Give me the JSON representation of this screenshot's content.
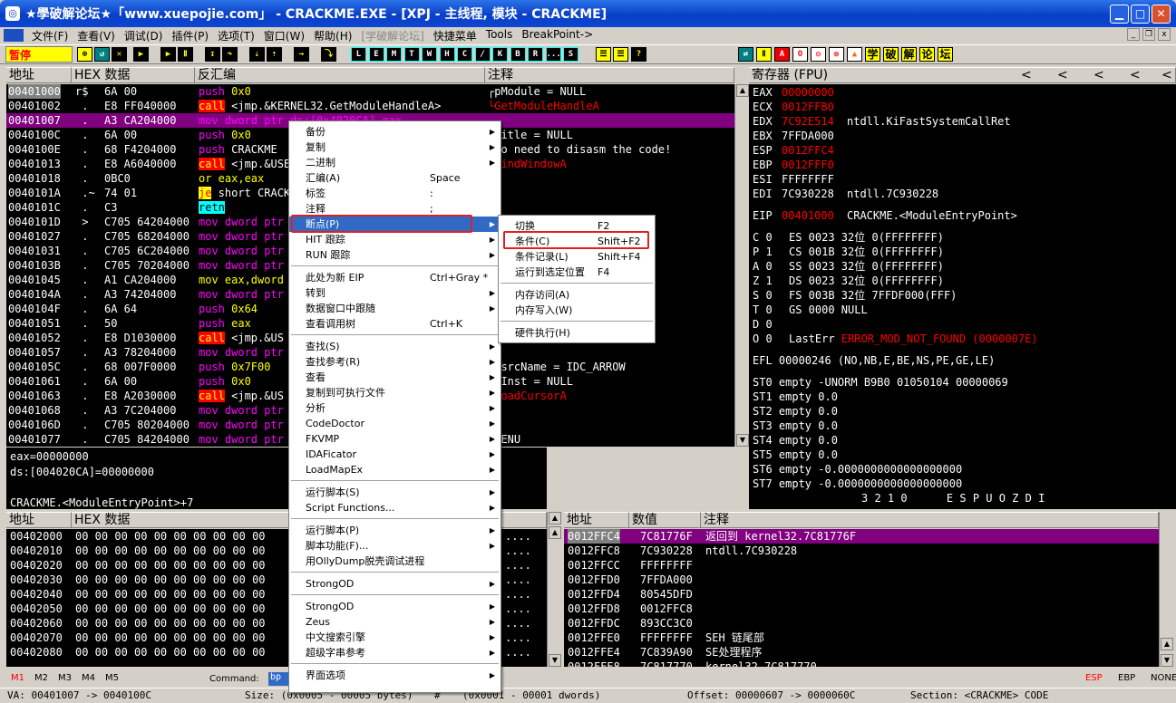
{
  "window": {
    "title": "★學破解论坛★「www.xuepojie.com」 - CRACKME.EXE - [XPJ - 主线程, 模块 - CRACKME]"
  },
  "menu": [
    "文件(F)",
    "查看(V)",
    "调试(D)",
    "插件(P)",
    "选项(T)",
    "窗口(W)",
    "帮助(H)",
    "[学破解论坛]",
    "快捷菜单",
    "Tools",
    "BreakPoint->"
  ],
  "toolbar": {
    "status": "暂停",
    "letters": [
      "L",
      "E",
      "M",
      "T",
      "W",
      "H",
      "C",
      "/",
      "K",
      "B",
      "R",
      "...",
      "S"
    ],
    "cn_buttons": [
      "学",
      "破",
      "解",
      "论",
      "坛"
    ]
  },
  "cpu": {
    "headers": {
      "addr": "地址",
      "hex": "HEX 数据",
      "disasm": "反汇编",
      "comment": "注释"
    },
    "rows": [
      {
        "a": "00401000",
        "m": "r$",
        "h": "6A 00",
        "d": [
          [
            "push",
            "mag"
          ],
          [
            " 0x0",
            "yel"
          ]
        ],
        "c": "┌pModule = NULL"
      },
      {
        "a": "00401002",
        "m": " .",
        "h": "E8 FF040000",
        "d": [
          [
            "call",
            "callbg"
          ],
          [
            " <jmp.&KERNEL32.GetModuleHandleA>",
            ""
          ]
        ],
        "c": "└GetModuleHandleA",
        "cc": "red"
      },
      {
        "a": "00401007",
        "m": " .",
        "h": "A3 CA204000",
        "d": [
          [
            "mov dword ptr ds:[0x4020CA],eax",
            ""
          ]
        ],
        "c": "",
        "sel": true
      },
      {
        "a": "0040100C",
        "m": " .",
        "h": "6A 00",
        "d": [
          [
            "push",
            "mag"
          ],
          [
            " 0x0",
            "yel"
          ]
        ],
        "c": "┌Title = NULL"
      },
      {
        "a": "0040100E",
        "m": " .",
        "h": "68 F4204000",
        "d": [
          [
            "push",
            "mag"
          ],
          [
            " CRACKME",
            ""
          ]
        ],
        "c": "│No need to disasm the code!"
      },
      {
        "a": "00401013",
        "m": " .",
        "h": "E8 A6040000",
        "d": [
          [
            "call",
            "callbg"
          ],
          [
            " <jmp.&USER32.FindWindowA>",
            ""
          ]
        ],
        "c": "└FindWindowA",
        "cc": "red"
      },
      {
        "a": "00401018",
        "m": " .",
        "h": "0BC0",
        "d": [
          [
            "or eax,eax",
            "yel"
          ]
        ],
        "c": ""
      },
      {
        "a": "0040101A",
        "m": " .~",
        "h": "74 01",
        "d": [
          [
            "je",
            "jebg"
          ],
          [
            " short CRACKME.0040101D",
            ""
          ]
        ],
        "c": ""
      },
      {
        "a": "0040101C",
        "m": " .",
        "h": "C3",
        "d": [
          [
            "retn",
            "retbg"
          ]
        ],
        "c": ""
      },
      {
        "a": "0040101D",
        "m": " >",
        "h": "C705 64204000",
        "d": [
          [
            "mov dword ptr",
            "mag"
          ]
        ],
        "c": ""
      },
      {
        "a": "00401027",
        "m": " .",
        "h": "C705 68204000",
        "d": [
          [
            "mov dword ptr",
            "mag"
          ]
        ],
        "c": ""
      },
      {
        "a": "00401031",
        "m": " .",
        "h": "C705 6C204000",
        "d": [
          [
            "mov dword ptr",
            "mag"
          ]
        ],
        "c": ""
      },
      {
        "a": "0040103B",
        "m": " .",
        "h": "C705 70204000",
        "d": [
          [
            "mov dword ptr",
            "mag"
          ]
        ],
        "c": ""
      },
      {
        "a": "00401045",
        "m": " .",
        "h": "A1 CA204000",
        "d": [
          [
            "mov eax,dword",
            "yel"
          ]
        ],
        "c": ""
      },
      {
        "a": "0040104A",
        "m": " .",
        "h": "A3 74204000",
        "d": [
          [
            "mov dword ptr",
            "mag"
          ]
        ],
        "c": ""
      },
      {
        "a": "0040104F",
        "m": " .",
        "h": "6A 64",
        "d": [
          [
            "push",
            "mag"
          ],
          [
            " 0x64",
            "yel"
          ]
        ],
        "c": ""
      },
      {
        "a": "00401051",
        "m": " .",
        "h": "50",
        "d": [
          [
            "push",
            "mag"
          ],
          [
            " eax",
            "yel"
          ]
        ],
        "c": ""
      },
      {
        "a": "00401052",
        "m": " .",
        "h": "E8 D1030000",
        "d": [
          [
            "call",
            "callbg"
          ],
          [
            " <jmp.&US",
            ""
          ]
        ],
        "c": ""
      },
      {
        "a": "00401057",
        "m": " .",
        "h": "A3 78204000",
        "d": [
          [
            "mov dword ptr",
            "mag"
          ]
        ],
        "c": ""
      },
      {
        "a": "0040105C",
        "m": " .",
        "h": "68 007F0000",
        "d": [
          [
            "push",
            "mag"
          ],
          [
            " 0x7F00",
            "yel"
          ]
        ],
        "c": "│RsrcName = IDC_ARROW"
      },
      {
        "a": "00401061",
        "m": " .",
        "h": "6A 00",
        "d": [
          [
            "push",
            "mag"
          ],
          [
            " 0x0",
            "yel"
          ]
        ],
        "c": "│hInst = NULL"
      },
      {
        "a": "00401063",
        "m": " .",
        "h": "E8 A2030000",
        "d": [
          [
            "call",
            "callbg"
          ],
          [
            " <jmp.&US",
            ""
          ]
        ],
        "c": "└LoadCursorA",
        "cc": "red"
      },
      {
        "a": "00401068",
        "m": " .",
        "h": "A3 7C204000",
        "d": [
          [
            "mov dword ptr",
            "mag"
          ]
        ],
        "c": ""
      },
      {
        "a": "0040106D",
        "m": " .",
        "h": "C705 80204000",
        "d": [
          [
            "mov dword ptr",
            "mag"
          ]
        ],
        "c": ""
      },
      {
        "a": "00401077",
        "m": " .",
        "h": "C705 84204000",
        "d": [
          [
            "mov dword ptr",
            "mag"
          ]
        ],
        "c": "│MENU"
      }
    ],
    "info": [
      "eax=00000000",
      "ds:[004020CA]=00000000",
      "",
      "CRACKME.<ModuleEntryPoint>+7"
    ]
  },
  "registers": {
    "header": "寄存器 (FPU)",
    "gp": [
      [
        "EAX",
        "00000000",
        "",
        true
      ],
      [
        "ECX",
        "0012FFB0",
        "",
        true
      ],
      [
        "EDX",
        "7C92E514",
        "ntdll.KiFastSystemCallRet",
        true
      ],
      [
        "EBX",
        "7FFDA000",
        "",
        false
      ],
      [
        "ESP",
        "0012FFC4",
        "",
        true
      ],
      [
        "EBP",
        "0012FFF0",
        "",
        true
      ],
      [
        "ESI",
        "FFFFFFFF",
        "",
        false
      ],
      [
        "EDI",
        "7C930228",
        "ntdll.7C930228",
        false
      ]
    ],
    "eip": [
      "EIP",
      "00401000",
      "CRACKME.<ModuleEntryPoint>"
    ],
    "flags": [
      [
        "C 0",
        "ES 0023 32位 0(FFFFFFFF)",
        false
      ],
      [
        "P 1",
        "CS 001B 32位 0(FFFFFFFF)",
        true
      ],
      [
        "A 0",
        "SS 0023 32位 0(FFFFFFFF)",
        false
      ],
      [
        "Z 1",
        "DS 0023 32位 0(FFFFFFFF)",
        true
      ],
      [
        "S 0",
        "FS 003B 32位 7FFDF000(FFF)",
        false
      ],
      [
        "T 0",
        "GS 0000 NULL",
        false
      ],
      [
        "D 0",
        "",
        false
      ],
      [
        "O 0",
        "LastErr ERROR_MOD_NOT_FOUND (0000007E)",
        false
      ]
    ],
    "efl": "EFL 00000246 (NO,NB,E,BE,NS,PE,GE,LE)",
    "st": [
      "ST0 empty -UNORM B9B0 01050104 00000069",
      "ST1 empty 0.0",
      "ST2 empty 0.0",
      "ST3 empty 0.0",
      "ST4 empty 0.0",
      "ST5 empty 0.0",
      "ST6 empty -0.0000000000000000000",
      "ST7 empty -0.0000000000000000000"
    ],
    "fpu_bits": "3 2 1 0      E S P U O Z D I"
  },
  "dump": {
    "headers": {
      "addr": "地址",
      "hex": "HEX 数据"
    },
    "rows": [
      "00402000",
      "00402010",
      "00402020",
      "00402030",
      "00402040",
      "00402050",
      "00402060",
      "00402070",
      "00402080"
    ],
    "bytes": "00 00 00 00 00 00 00 00 00 00",
    "ascii": "...."
  },
  "stack": {
    "headers": {
      "addr": "地址",
      "val": "数值",
      "comment": "注释"
    },
    "rows": [
      [
        "0012FFC4",
        "7C81776F",
        "返回到 kernel32.7C81776F",
        true
      ],
      [
        "0012FFC8",
        "7C930228",
        "ntdll.7C930228",
        false
      ],
      [
        "0012FFCC",
        "FFFFFFFF",
        "",
        false
      ],
      [
        "0012FFD0",
        "7FFDA000",
        "",
        false
      ],
      [
        "0012FFD4",
        "80545DFD",
        "",
        false
      ],
      [
        "0012FFD8",
        "0012FFC8",
        "",
        false
      ],
      [
        "0012FFDC",
        "893CC3C0",
        "",
        false
      ],
      [
        "0012FFE0",
        "FFFFFFFF",
        "SEH 链尾部",
        false
      ],
      [
        "0012FFE4",
        "7C839A90",
        "SE处理程序",
        false
      ],
      [
        "0012FFE8",
        "7C817770",
        "kernel32.7C817770",
        false
      ]
    ]
  },
  "context_menu": {
    "items": [
      {
        "label": "备份",
        "sub": true
      },
      {
        "label": "复制",
        "sub": true
      },
      {
        "label": "二进制",
        "sub": true
      },
      {
        "label": "汇编(A)",
        "shortcut": "Space"
      },
      {
        "label": "标签",
        "shortcut": ":"
      },
      {
        "label": "注释",
        "shortcut": ";"
      },
      {
        "label": "断点(P)",
        "sub": true,
        "hl": true
      },
      {
        "label": "HIT 跟踪",
        "sub": true
      },
      {
        "label": "RUN 跟踪",
        "sub": true
      },
      {
        "sep": true
      },
      {
        "label": "此处为新 EIP",
        "shortcut": "Ctrl+Gray *"
      },
      {
        "label": "转到",
        "sub": true
      },
      {
        "label": "数据窗口中跟随",
        "sub": true
      },
      {
        "label": "查看调用树",
        "shortcut": "Ctrl+K"
      },
      {
        "sep": true
      },
      {
        "label": "查找(S)",
        "sub": true
      },
      {
        "label": "查找参考(R)",
        "sub": true
      },
      {
        "label": "查看",
        "sub": true
      },
      {
        "label": "复制到可执行文件",
        "sub": true
      },
      {
        "label": "分析",
        "sub": true
      },
      {
        "label": "CodeDoctor",
        "sub": true
      },
      {
        "label": "FKVMP",
        "sub": true
      },
      {
        "label": "IDAFicator",
        "sub": true
      },
      {
        "label": "LoadMapEx",
        "sub": true
      },
      {
        "sep": true
      },
      {
        "label": "运行脚本(S)",
        "sub": true
      },
      {
        "label": "Script Functions...",
        "sub": true
      },
      {
        "sep": true
      },
      {
        "label": "运行脚本(P)",
        "sub": true
      },
      {
        "label": "脚本功能(F)...",
        "sub": true
      },
      {
        "label": "用OllyDump脱壳调试进程"
      },
      {
        "sep": true
      },
      {
        "label": "StrongOD",
        "sub": true
      },
      {
        "sep": true
      },
      {
        "label": "StrongOD",
        "sub": true
      },
      {
        "label": "Zeus",
        "sub": true
      },
      {
        "label": "中文搜索引擎",
        "sub": true
      },
      {
        "label": "超级字串参考",
        "sub": true
      },
      {
        "sep": true
      },
      {
        "label": "界面选项",
        "sub": true
      }
    ]
  },
  "submenu": {
    "items": [
      {
        "label": "切换",
        "shortcut": "F2"
      },
      {
        "label": "条件(C)",
        "shortcut": "Shift+F2"
      },
      {
        "label": "条件记录(L)",
        "shortcut": "Shift+F4"
      },
      {
        "label": "运行到选定位置",
        "shortcut": "F4"
      },
      {
        "sep": true
      },
      {
        "label": "内存访问(A)"
      },
      {
        "label": "内存写入(W)"
      },
      {
        "sep": true
      },
      {
        "label": "硬件执行(H)"
      }
    ]
  },
  "cmdline": {
    "tabs": [
      "M1",
      "M2",
      "M3",
      "M4",
      "M5"
    ],
    "label": "Command:",
    "value": "bp",
    "right": [
      "ESP",
      "EBP",
      "NONE"
    ]
  },
  "status": {
    "va": "VA: 00401007 -> 0040100C",
    "size": "Size: (0x0005 - 00005 bytes)",
    "hash": "#",
    "dwords": "(0x0001 - 00001 dwords)",
    "offset": "Offset: 00000607 -> 0000060C",
    "section": "Section: <CRACKME> CODE"
  }
}
